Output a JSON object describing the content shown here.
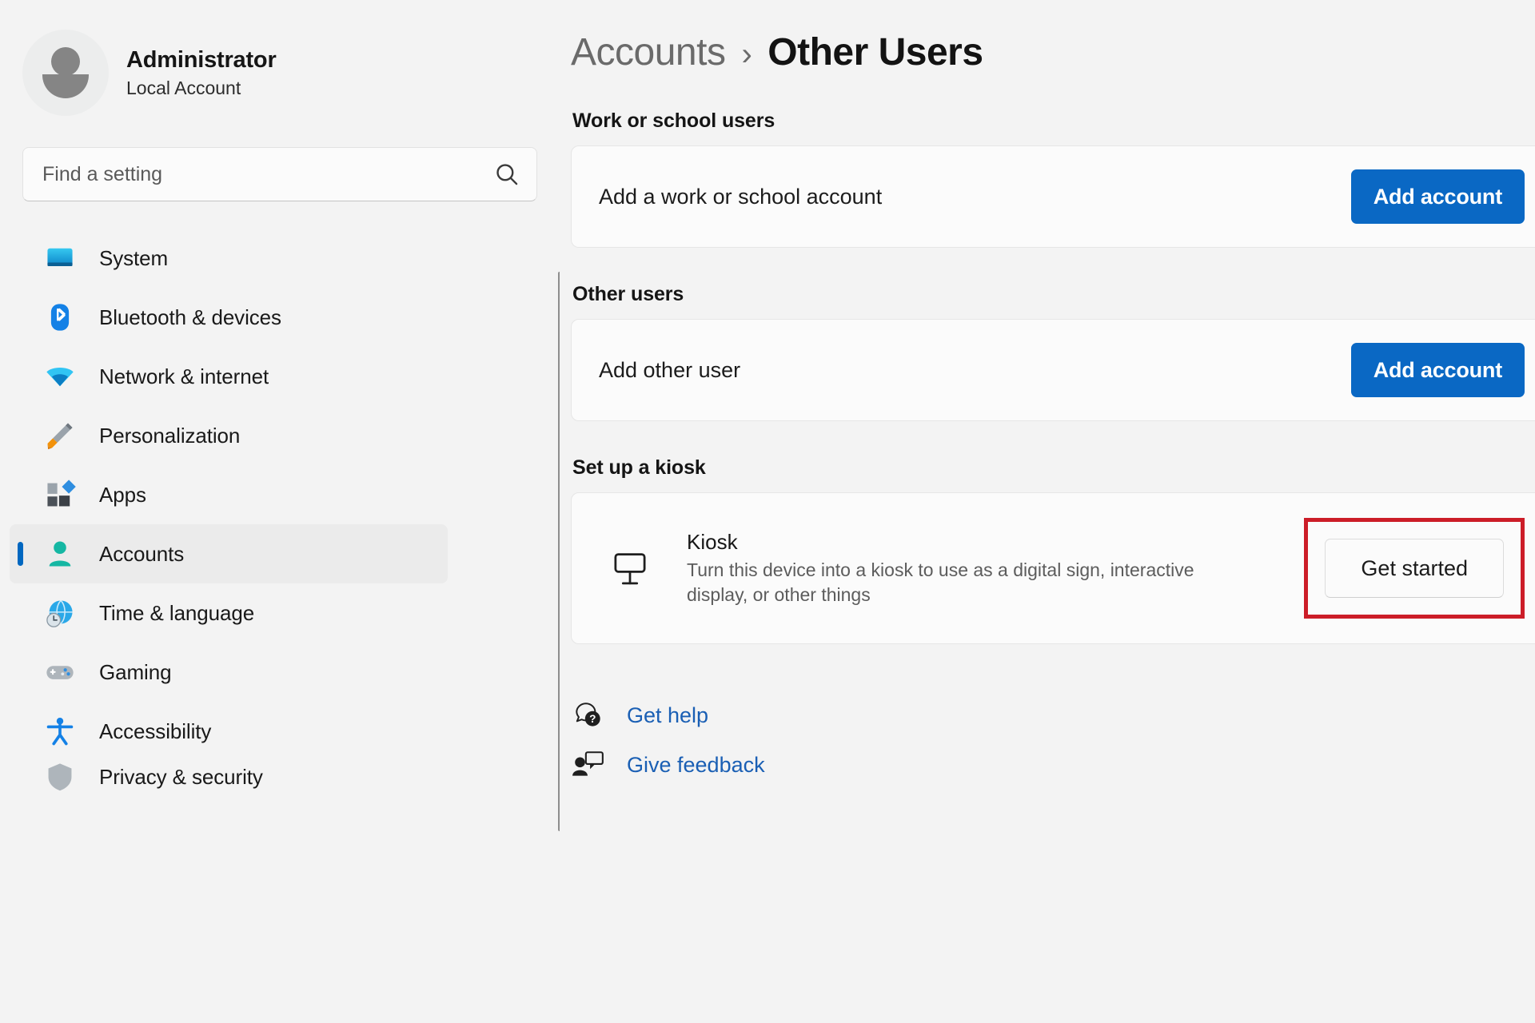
{
  "account": {
    "name": "Administrator",
    "type": "Local Account",
    "avatar_icon": "person-avatar-icon"
  },
  "search": {
    "placeholder": "Find a setting",
    "value": "",
    "icon": "search-icon"
  },
  "sidebar": {
    "items": [
      {
        "label": "System",
        "icon": "monitor-icon",
        "selected": false
      },
      {
        "label": "Bluetooth & devices",
        "icon": "bluetooth-icon",
        "selected": false
      },
      {
        "label": "Network & internet",
        "icon": "wifi-icon",
        "selected": false
      },
      {
        "label": "Personalization",
        "icon": "paintbrush-icon",
        "selected": false
      },
      {
        "label": "Apps",
        "icon": "apps-grid-icon",
        "selected": false
      },
      {
        "label": "Accounts",
        "icon": "person-icon",
        "selected": true
      },
      {
        "label": "Time & language",
        "icon": "globe-clock-icon",
        "selected": false
      },
      {
        "label": "Gaming",
        "icon": "gamepad-icon",
        "selected": false
      },
      {
        "label": "Accessibility",
        "icon": "accessibility-icon",
        "selected": false
      },
      {
        "label": "Privacy & security",
        "icon": "shield-icon",
        "selected": false
      }
    ]
  },
  "breadcrumb": {
    "parent": "Accounts",
    "separator": "›",
    "current": "Other Users"
  },
  "sections": {
    "work_or_school": {
      "title": "Work or school users",
      "row_label": "Add a work or school account",
      "button_label": "Add account"
    },
    "other_users": {
      "title": "Other users",
      "row_label": "Add other user",
      "button_label": "Add account"
    },
    "kiosk": {
      "title": "Set up a kiosk",
      "item_title": "Kiosk",
      "item_description": "Turn this device into a kiosk to use as a digital sign, interactive display, or other things",
      "item_icon": "kiosk-sign-icon",
      "button_label": "Get started"
    }
  },
  "footer_links": [
    {
      "label": "Get help",
      "icon": "help-question-icon"
    },
    {
      "label": "Give feedback",
      "icon": "feedback-person-icon"
    }
  ],
  "colors": {
    "accent_blue": "#0a68c4",
    "link_blue": "#1a5fb4",
    "highlight_red": "#cc1d28",
    "selection_indicator": "#0067c0",
    "page_background": "#f3f3f3",
    "card_background": "#fbfbfb"
  }
}
